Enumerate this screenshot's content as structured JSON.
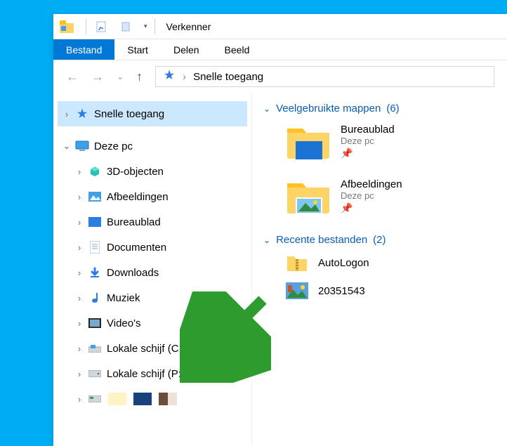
{
  "title": "Verkenner",
  "ribbon": {
    "file": "Bestand",
    "tabs": [
      "Start",
      "Delen",
      "Beeld"
    ]
  },
  "breadcrumb": {
    "current": "Snelle toegang"
  },
  "tree": {
    "quick_access": "Snelle toegang",
    "this_pc": "Deze pc",
    "items": [
      "3D-objecten",
      "Afbeeldingen",
      "Bureaublad",
      "Documenten",
      "Downloads",
      "Muziek",
      "Video's",
      "Lokale schijf (C:)",
      "Lokale schijf (P:)"
    ]
  },
  "content": {
    "group_folders_label": "Veelgebruikte mappen",
    "group_folders_count": "(6)",
    "folders": [
      {
        "name": "Bureaublad",
        "loc": "Deze pc"
      },
      {
        "name": "Afbeeldingen",
        "loc": "Deze pc"
      }
    ],
    "group_recent_label": "Recente bestanden",
    "group_recent_count": "(2)",
    "recent": [
      {
        "name": "AutoLogon"
      },
      {
        "name": "20351543"
      }
    ]
  },
  "swatch_colors": [
    "#fff3c4",
    "#17417a",
    "#9d8472",
    "#ede2d5"
  ]
}
